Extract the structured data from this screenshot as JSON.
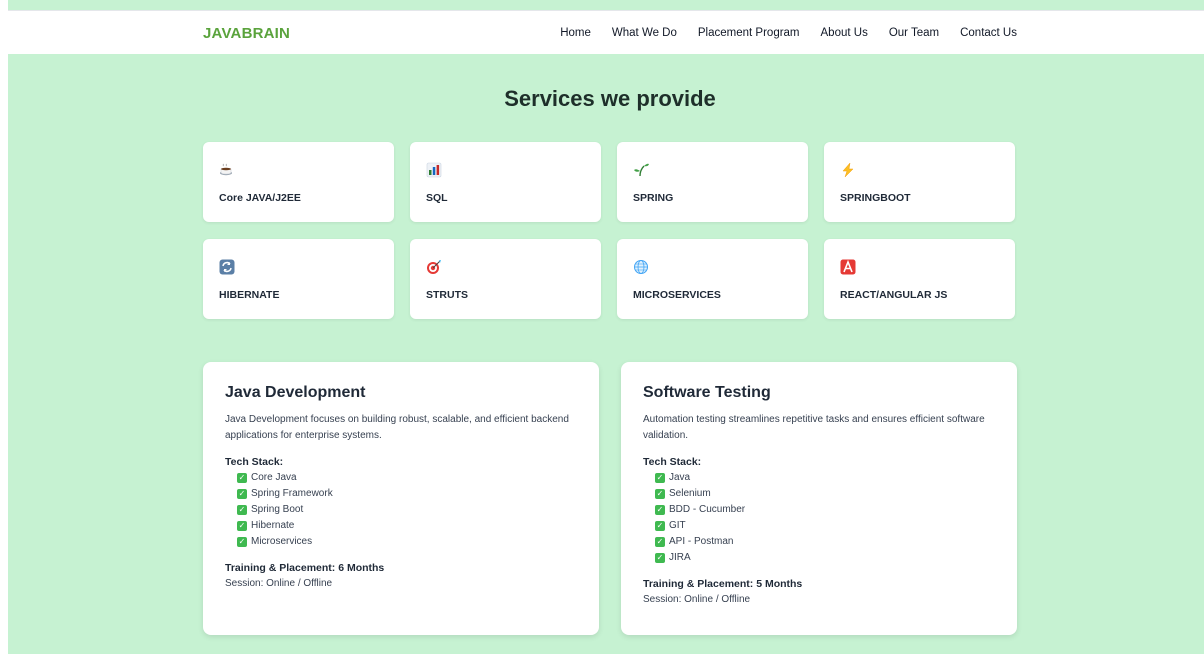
{
  "brand": "JAVABRAIN",
  "nav": [
    "Home",
    "What We Do",
    "Placement Program",
    "About Us",
    "Our Team",
    "Contact Us"
  ],
  "services": {
    "title": "Services we provide",
    "items": [
      {
        "label": "Core JAVA/J2EE",
        "icon": "coffee-icon"
      },
      {
        "label": "SQL",
        "icon": "bar-chart-icon"
      },
      {
        "label": "SPRING",
        "icon": "seedling-icon"
      },
      {
        "label": "SPRINGBOOT",
        "icon": "lightning-icon"
      },
      {
        "label": "HIBERNATE",
        "icon": "refresh-icon"
      },
      {
        "label": "STRUTS",
        "icon": "target-icon"
      },
      {
        "label": "MICROSERVICES",
        "icon": "globe-icon"
      },
      {
        "label": "REACT/ANGULAR JS",
        "icon": "letter-a-icon"
      }
    ]
  },
  "courses": [
    {
      "title": "Java Development",
      "description": "Java Development focuses on building robust, scalable, and efficient backend applications for enterprise systems.",
      "stack_label": "Tech Stack:",
      "stack": [
        "Core Java",
        "Spring Framework",
        "Spring Boot",
        "Hibernate",
        "Microservices"
      ],
      "duration": "Training & Placement: 6 Months",
      "session": "Session: Online / Offline"
    },
    {
      "title": "Software Testing",
      "description": "Automation testing streamlines repetitive tasks and ensures efficient software validation.",
      "stack_label": "Tech Stack:",
      "stack": [
        "Java",
        "Selenium",
        "BDD - Cucumber",
        "GIT",
        "API - Postman",
        "JIRA"
      ],
      "duration": "Training & Placement: 5 Months",
      "session": "Session: Online / Offline"
    }
  ],
  "colors": {
    "brand": "#5aa33c",
    "background": "#c6f2d2",
    "check": "#3fb950"
  }
}
